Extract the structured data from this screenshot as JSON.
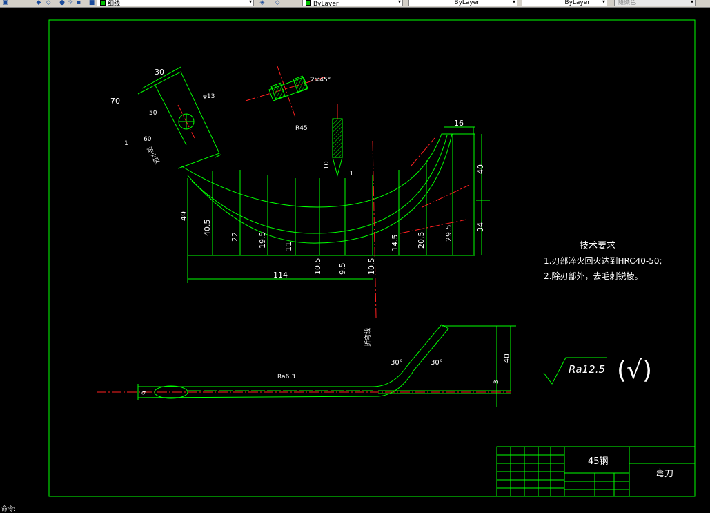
{
  "toolbar": {
    "linetype_value": "细线",
    "color_value": "ByLayer",
    "linetype2_value": "ByLayer",
    "lineweight_value": "ByLayer",
    "plotstyle_value": "随颜色"
  },
  "drawing": {
    "colors": {
      "frame": "#00ff00",
      "centerline": "#ff2020",
      "dimension": "#00ff00",
      "text": "#ffffff"
    },
    "tech_title": "技术要求",
    "tech_line1": "1.刃部淬火回火达到HRC40-50;",
    "tech_line2": "2.除刃部外，去毛刺锐棱。",
    "roughness_symbol": "Ra12.5",
    "roughness_paren": "(√)",
    "material": "45钢",
    "part_name": "弯刀",
    "dims": {
      "d30": "30",
      "d50": "50",
      "d60": "60",
      "d70": "70",
      "d1a": "1",
      "d13": "φ13",
      "section": "2×45°",
      "rA": "R45",
      "d10": "10",
      "d1b": "1",
      "d16": "16",
      "d40a": "40",
      "d34": "34",
      "d49": "49",
      "d40_5": "40.5",
      "d22": "22",
      "d19_5": "19.5",
      "d11": "11",
      "d14_5": "14.5",
      "d20_5": "20.5",
      "d29_5": "29.5",
      "d10_5a": "10.5",
      "d9_5": "9.5",
      "d10_5b": "10.5",
      "d114": "114",
      "bend_label": "折弯线",
      "a30a": "30°",
      "a30b": "30°",
      "d40b": "40",
      "d3": "3",
      "d9": "9",
      "ra63": "Ra6.3",
      "label_zone": "淬火区"
    }
  },
  "status": {
    "command_text": "命令:"
  }
}
